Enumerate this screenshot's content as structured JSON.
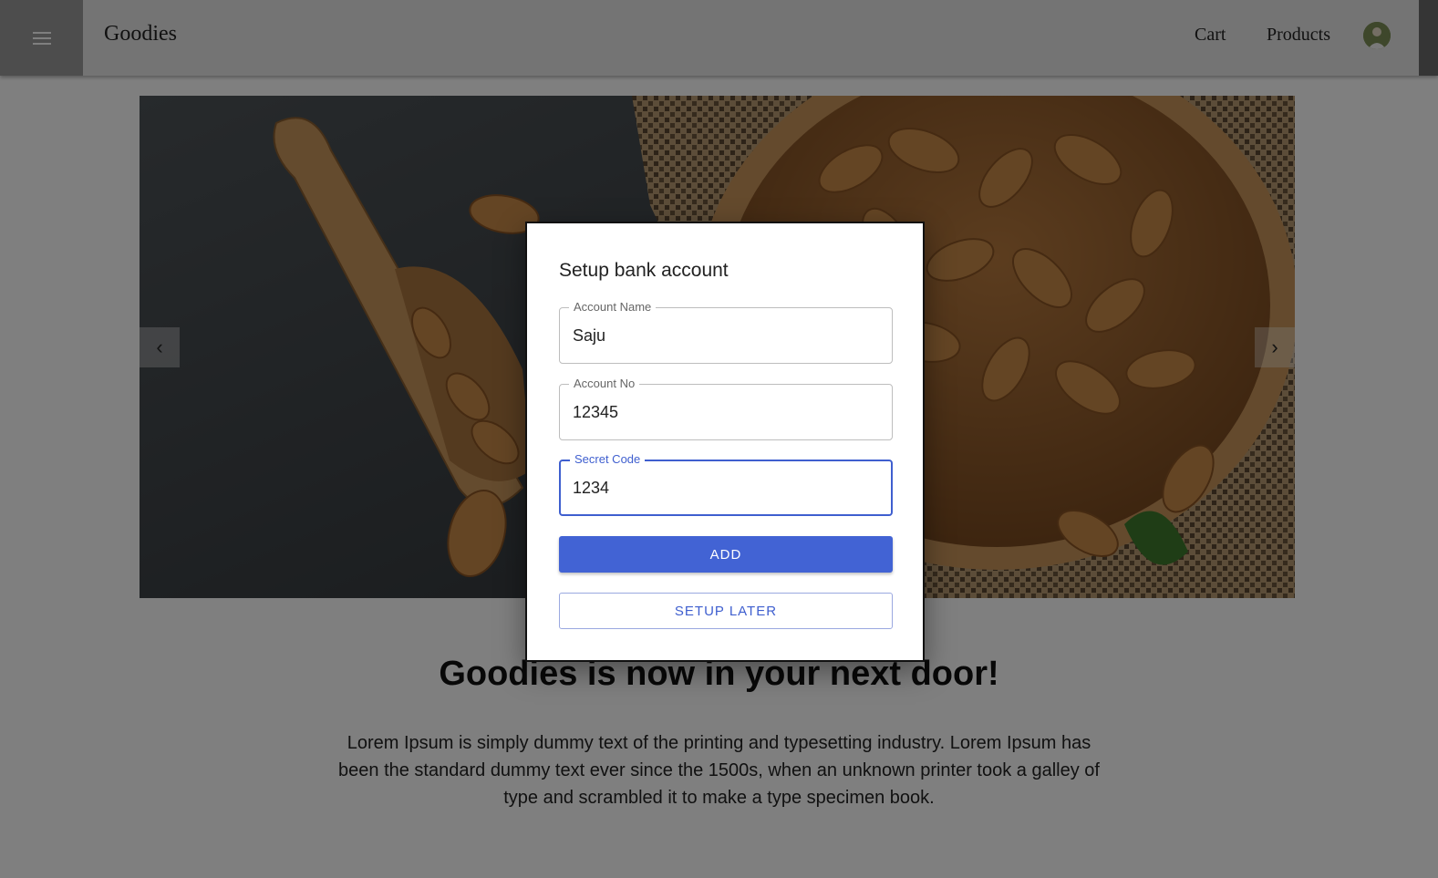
{
  "appbar": {
    "brand": "Goodies",
    "nav": {
      "cart": "Cart",
      "products": "Products"
    }
  },
  "carousel": {
    "prev_icon": "chevron-left-icon",
    "next_icon": "chevron-right-icon"
  },
  "hero": {
    "headline": "Goodies is now in your next door!",
    "body": "Lorem Ipsum is simply dummy text of the printing and typesetting industry. Lorem Ipsum has been the standard dummy text ever since the 1500s, when an unknown printer took a galley of type and scrambled it to make a type specimen book."
  },
  "dialog": {
    "title": "Setup bank account",
    "fields": [
      {
        "label": "Account Name",
        "value": "Saju"
      },
      {
        "label": "Account No",
        "value": "12345"
      },
      {
        "label": "Secret Code",
        "value": "1234"
      }
    ],
    "add_label": "ADD",
    "later_label": "SETUP LATER"
  },
  "colors": {
    "primary": "#4263d4",
    "overlay": "rgba(0,0,0,0.5)"
  }
}
